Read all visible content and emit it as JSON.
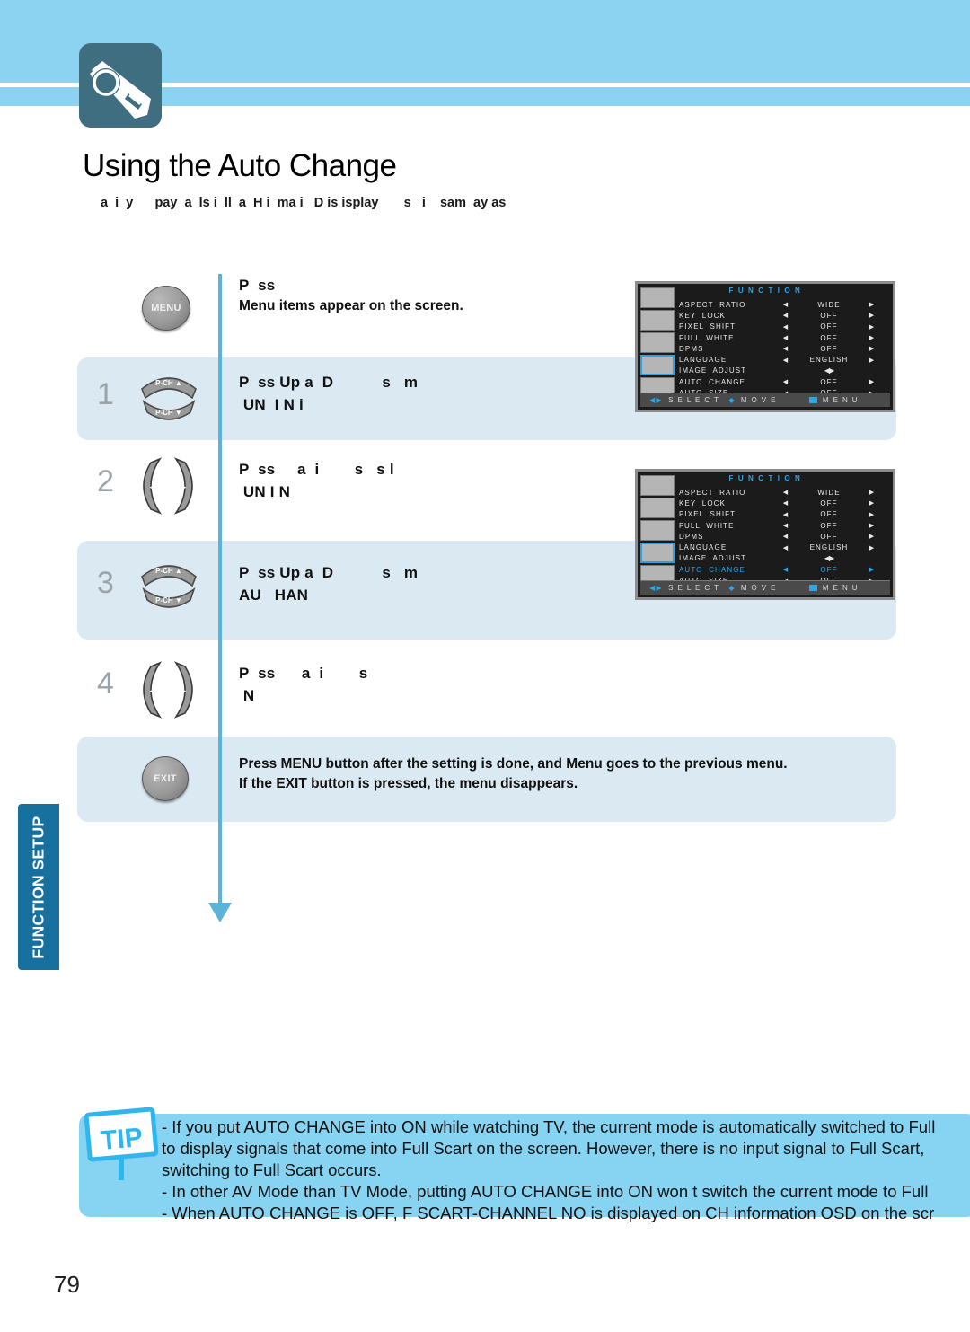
{
  "header": {
    "logo_icon": "projector-camera-icon",
    "banner_color": "#8bd3f0"
  },
  "title": "Using the Auto Change",
  "subtitle": "a  i  y      pay  a  ls i  ll  a  H i  ma i   D is isplay       s   i    sam  ay as",
  "intro_step": {
    "button_label": "MENU",
    "button_icon": "menu-button-icon",
    "line1": "P  ss",
    "note": "Menu items appear on the screen."
  },
  "steps": [
    {
      "number": "1",
      "button_icon": "p-ch-up-down-button",
      "button_up_label": "P-CH ▲",
      "button_down_label": "P-CH ▼",
      "line1": "P  ss Up a  D           s   m",
      "line2": " UN  I N i"
    },
    {
      "number": "2",
      "button_icon": "left-right-button",
      "button_left_label": "◀",
      "button_right_label": "▶",
      "line1": "P  ss     a  i        s   s l",
      "line2": " UN I N"
    },
    {
      "number": "3",
      "button_icon": "p-ch-up-down-button",
      "button_up_label": "P-CH ▲",
      "button_down_label": "P-CH ▼",
      "line1": "P  ss Up a  D           s   m",
      "line2": "AU   HAN"
    },
    {
      "number": "4",
      "button_icon": "left-right-button",
      "button_left_label": "◀",
      "button_right_label": "▶",
      "line1": "P  ss      a  i        s",
      "line2": " N"
    }
  ],
  "exit_step": {
    "button_label": "EXIT",
    "button_icon": "exit-button-icon",
    "line1": "Press MENU button after the setting is done, and Menu goes to the previous menu.",
    "line2": "If the EXIT button is pressed, the menu disappears."
  },
  "osd": {
    "title": "F U N C T I O N",
    "accent_color": "#29a7e8",
    "sidebar_squares": 5,
    "sidebar_selected_index": 3,
    "rows": [
      {
        "label": "ASPECT  RATIO",
        "value": "WIDE",
        "arrows": true
      },
      {
        "label": "KEY  LOCK",
        "value": "OFF",
        "arrows": true
      },
      {
        "label": "PIXEL  SHIFT",
        "value": "OFF",
        "arrows": true
      },
      {
        "label": "FULL  WHITE",
        "value": "OFF",
        "arrows": true
      },
      {
        "label": "DPMS",
        "value": "OFF",
        "arrows": true
      },
      {
        "label": "LANGUAGE",
        "value": "ENGLISH",
        "arrows": true
      },
      {
        "label": "IMAGE  ADJUST",
        "value": "◀▶",
        "arrows": false
      },
      {
        "label": "AUTO  CHANGE",
        "value": "OFF",
        "arrows": true
      },
      {
        "label": "AUTO  SIZE",
        "value": "OFF",
        "arrows": true
      }
    ],
    "highlight_row_index_screen2": 7,
    "footer": {
      "select": "S E L E C T",
      "move": "M O V E",
      "menu": "M E N U",
      "select_icon": "left-right-arrows-icon",
      "move_icon": "up-down-diamond-icon",
      "menu_icon": "menu-square-icon"
    }
  },
  "side_tab": "FUNCTION SETUP",
  "tip": {
    "badge": "TIP",
    "badge_icon": "tip-sign-icon",
    "lines": [
      "- If you put AUTO CHANGE into ON while watching TV, the current mode is automatically switched to Full",
      "  to display signals that come into Full Scart on the screen. However, there is no input signal to Full Scart,",
      "  switching to Full Scart occurs.",
      "- In other AV Mode than TV Mode, putting AUTO CHANGE into ON won t switch the current mode to Full",
      "- When AUTO CHANGE is OFF, F SCART-CHANNEL NO is displayed on CH information OSD on the scr"
    ]
  },
  "page_number": "79"
}
